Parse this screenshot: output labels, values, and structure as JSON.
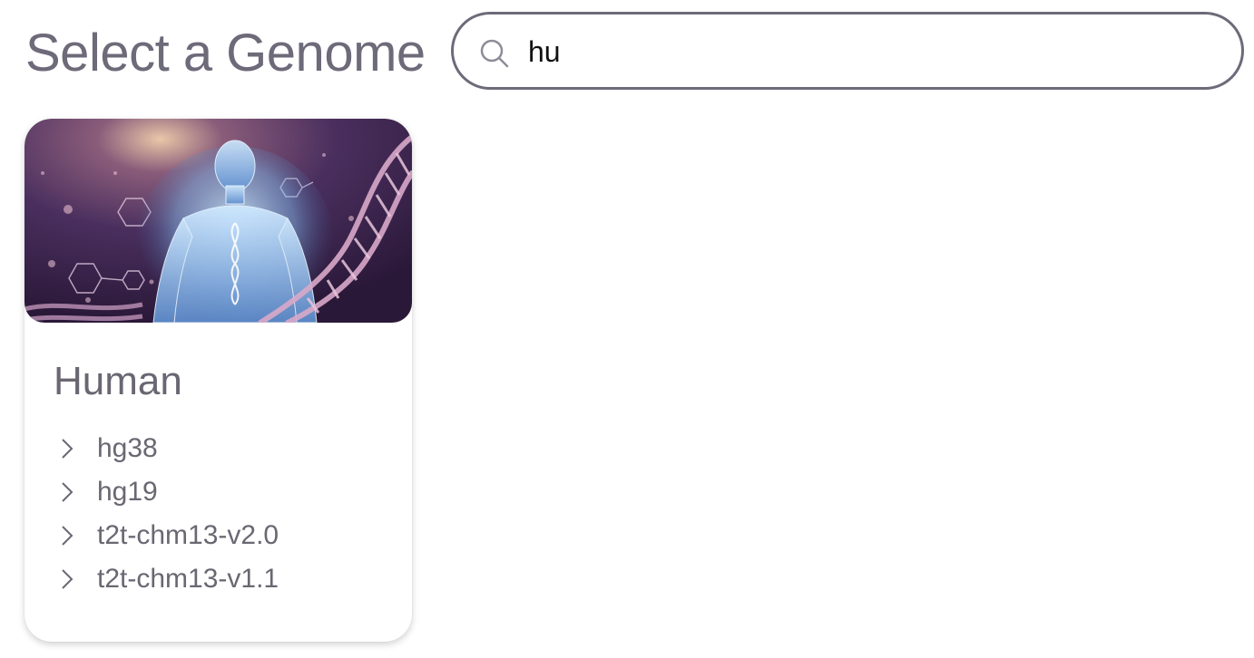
{
  "header": {
    "title": "Select a Genome",
    "search": {
      "value": "hu",
      "placeholder": "",
      "icon": "search-icon"
    }
  },
  "genomes": [
    {
      "name": "Human",
      "image_subject": "human figure with DNA helix",
      "assemblies": [
        {
          "label": "hg38",
          "icon": "chevron-right-icon"
        },
        {
          "label": "hg19",
          "icon": "chevron-right-icon"
        },
        {
          "label": "t2t-chm13-v2.0",
          "icon": "chevron-right-icon"
        },
        {
          "label": "t2t-chm13-v1.1",
          "icon": "chevron-right-icon"
        }
      ]
    }
  ],
  "colors": {
    "title_text": "#6e6a79",
    "search_border": "#6e6a79",
    "card_text": "#6a6772",
    "image_bg_dark": "#2a1d3a",
    "image_accent": "#c9a3d6"
  }
}
